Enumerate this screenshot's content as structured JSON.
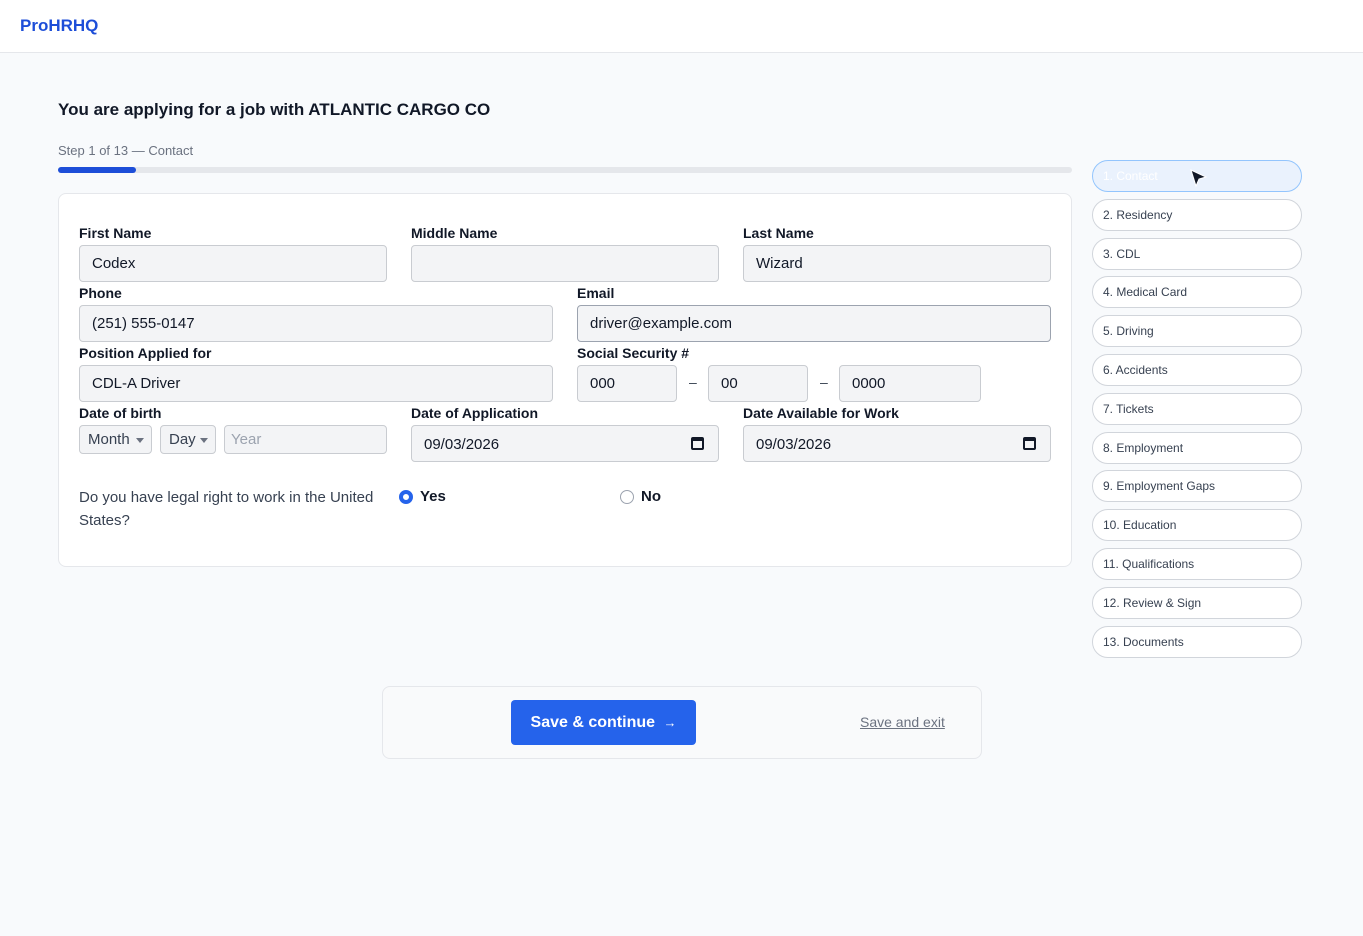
{
  "app": {
    "brand": "ProHRHQ"
  },
  "header": {
    "title": "You are applying for a job with ATLANTIC CARGO CO"
  },
  "progress": {
    "label": "Step 1 of 13 — Contact",
    "fraction": 0.077
  },
  "form": {
    "first_name": {
      "label": "First Name",
      "value": "Codex"
    },
    "middle_name": {
      "label": "Middle Name",
      "value": ""
    },
    "last_name": {
      "label": "Last Name",
      "value": "Wizard"
    },
    "phone": {
      "label": "Phone",
      "value": "(251) 555-0147"
    },
    "email": {
      "label": "Email",
      "value": "driver@example.com"
    },
    "position": {
      "label": "Position Applied for",
      "value": "CDL-A Driver"
    },
    "ssn": {
      "label": "Social Security #",
      "part1": "000",
      "part2": "00",
      "part3": "0000",
      "separator": "–"
    },
    "dob": {
      "label": "Date of birth",
      "month": "Month",
      "day": "Day",
      "year_placeholder": "Year"
    },
    "date_application": {
      "label": "Date of Application",
      "value": "09/03/2026"
    },
    "date_available": {
      "label": "Date Available for Work",
      "value": "09/03/2026"
    },
    "work_right": {
      "question": "Do you have legal right to work in the United States?",
      "yes": "Yes",
      "no": "No",
      "selected": "Yes"
    }
  },
  "steps": [
    {
      "label": "1. Contact",
      "active": true
    },
    {
      "label": "2. Residency"
    },
    {
      "label": "3. CDL"
    },
    {
      "label": "4. Medical Card"
    },
    {
      "label": "5. Driving"
    },
    {
      "label": "6. Accidents"
    },
    {
      "label": "7. Tickets"
    },
    {
      "label": "8. Employment"
    },
    {
      "label": "9. Employment Gaps"
    },
    {
      "label": "10. Education"
    },
    {
      "label": "11. Qualifications"
    },
    {
      "label": "12. Review & Sign"
    },
    {
      "label": "13. Documents"
    }
  ],
  "actions": {
    "continue_label": "Save & continue",
    "continue_arrow": "→",
    "exit_label": "Save and exit"
  },
  "icons": {
    "calendar": "calendar-icon",
    "cursor": "mouse-cursor-icon",
    "dropdown": "chevron-down-icon"
  },
  "colors": {
    "accent": "#2563eb",
    "brand": "#1d4ed8"
  }
}
